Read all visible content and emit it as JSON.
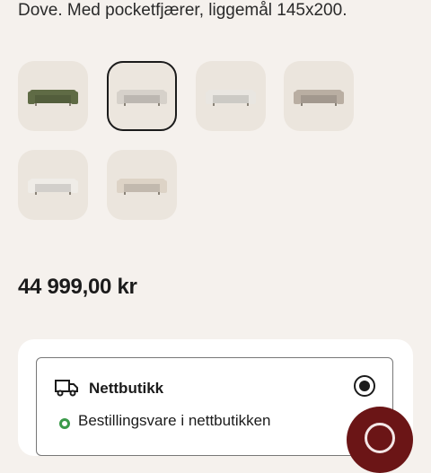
{
  "product": {
    "description": "Dove. Med pocketfjærer, liggemål 145x200.",
    "price": "44 999,00 kr"
  },
  "variants": [
    {
      "name": "sofa-variant-olive",
      "color": "#5f6b45",
      "selected": false
    },
    {
      "name": "sofa-variant-light-grey",
      "color": "#d6d1ca",
      "selected": true
    },
    {
      "name": "sofa-variant-white",
      "color": "#e9e6e1",
      "selected": false
    },
    {
      "name": "sofa-variant-taupe",
      "color": "#b9aea2",
      "selected": false
    },
    {
      "name": "sofa-variant-off-white",
      "color": "#efece7",
      "selected": false
    },
    {
      "name": "sofa-variant-beige",
      "color": "#ddd3c6",
      "selected": false
    }
  ],
  "delivery": {
    "option_title": "Nettbutikk",
    "option_icon": "truck-icon",
    "selected": true,
    "status_text": "Bestillingsvare i nettbutikken",
    "status_color": "#3b9a4a"
  },
  "chat": {
    "icon": "chat-icon",
    "color": "#6b1516"
  }
}
